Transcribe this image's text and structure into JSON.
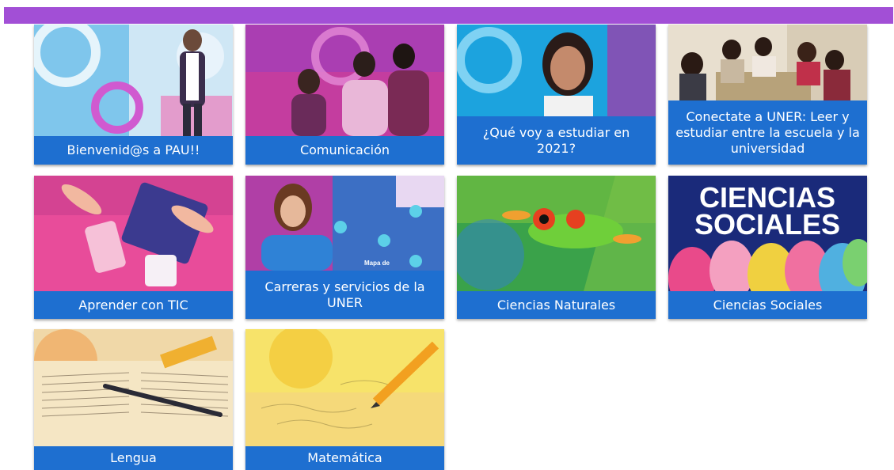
{
  "header": {
    "bar_color": "#a24fd6"
  },
  "caption_color": "#1e6fd0",
  "cards": [
    {
      "label": "Bienvenid@s a PAU!!"
    },
    {
      "label": "Comunicación"
    },
    {
      "label": "¿Qué voy a estudiar en 2021?"
    },
    {
      "label": "Conectate a UNER: Leer y estudiar entre la escuela y la universidad"
    },
    {
      "label": "Aprender con TIC"
    },
    {
      "label": "Carreras y servicios de la UNER"
    },
    {
      "label": "Ciencias Naturales"
    },
    {
      "label": "Ciencias Sociales"
    },
    {
      "label": "Lengua"
    },
    {
      "label": "Matemática"
    }
  ],
  "ciencias_sociales_image_text": {
    "line1": "CIENCIAS",
    "line2": "SOCIALES"
  },
  "map_label": "Mapa de"
}
